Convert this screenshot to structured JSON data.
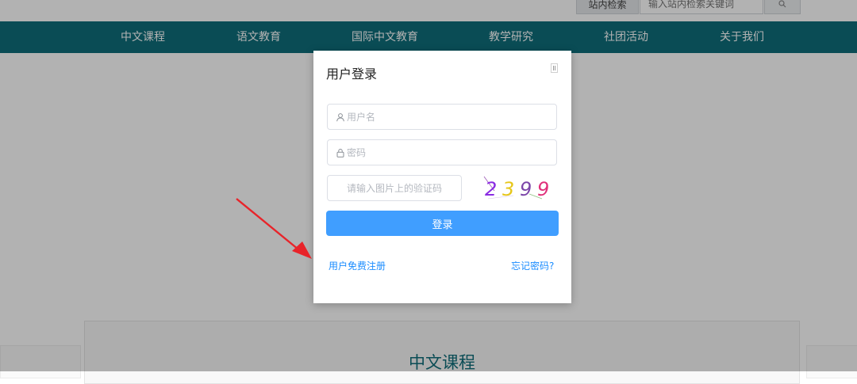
{
  "header": {
    "search_label": "站内检索",
    "search_placeholder": "输入站内检索关键词"
  },
  "nav": {
    "items": [
      "中文课程",
      "语文教育",
      "国际中文教育",
      "教学研究",
      "社团活动",
      "关于我们"
    ]
  },
  "section": {
    "title": "中文课程"
  },
  "login_modal": {
    "title": "用户登录",
    "username_placeholder": "用户名",
    "password_placeholder": "密码",
    "captcha_placeholder": "请输入图片上的验证码",
    "captcha_digits": [
      "2",
      "3",
      "9",
      "9"
    ],
    "login_label": "登录",
    "register_link": "用户免费注册",
    "forgot_link": "忘记密码?"
  },
  "colors": {
    "nav_bg": "#0f6e7a",
    "primary": "#409eff",
    "link": "#1a8cff",
    "arrow": "#e8242a",
    "captcha_digit_colors": [
      "#8a2be2",
      "#e6c619",
      "#7b45a8",
      "#e0307a"
    ]
  },
  "icons": {
    "username": "user-icon",
    "password": "lock-icon",
    "search": "search-icon",
    "close": "close-icon"
  }
}
